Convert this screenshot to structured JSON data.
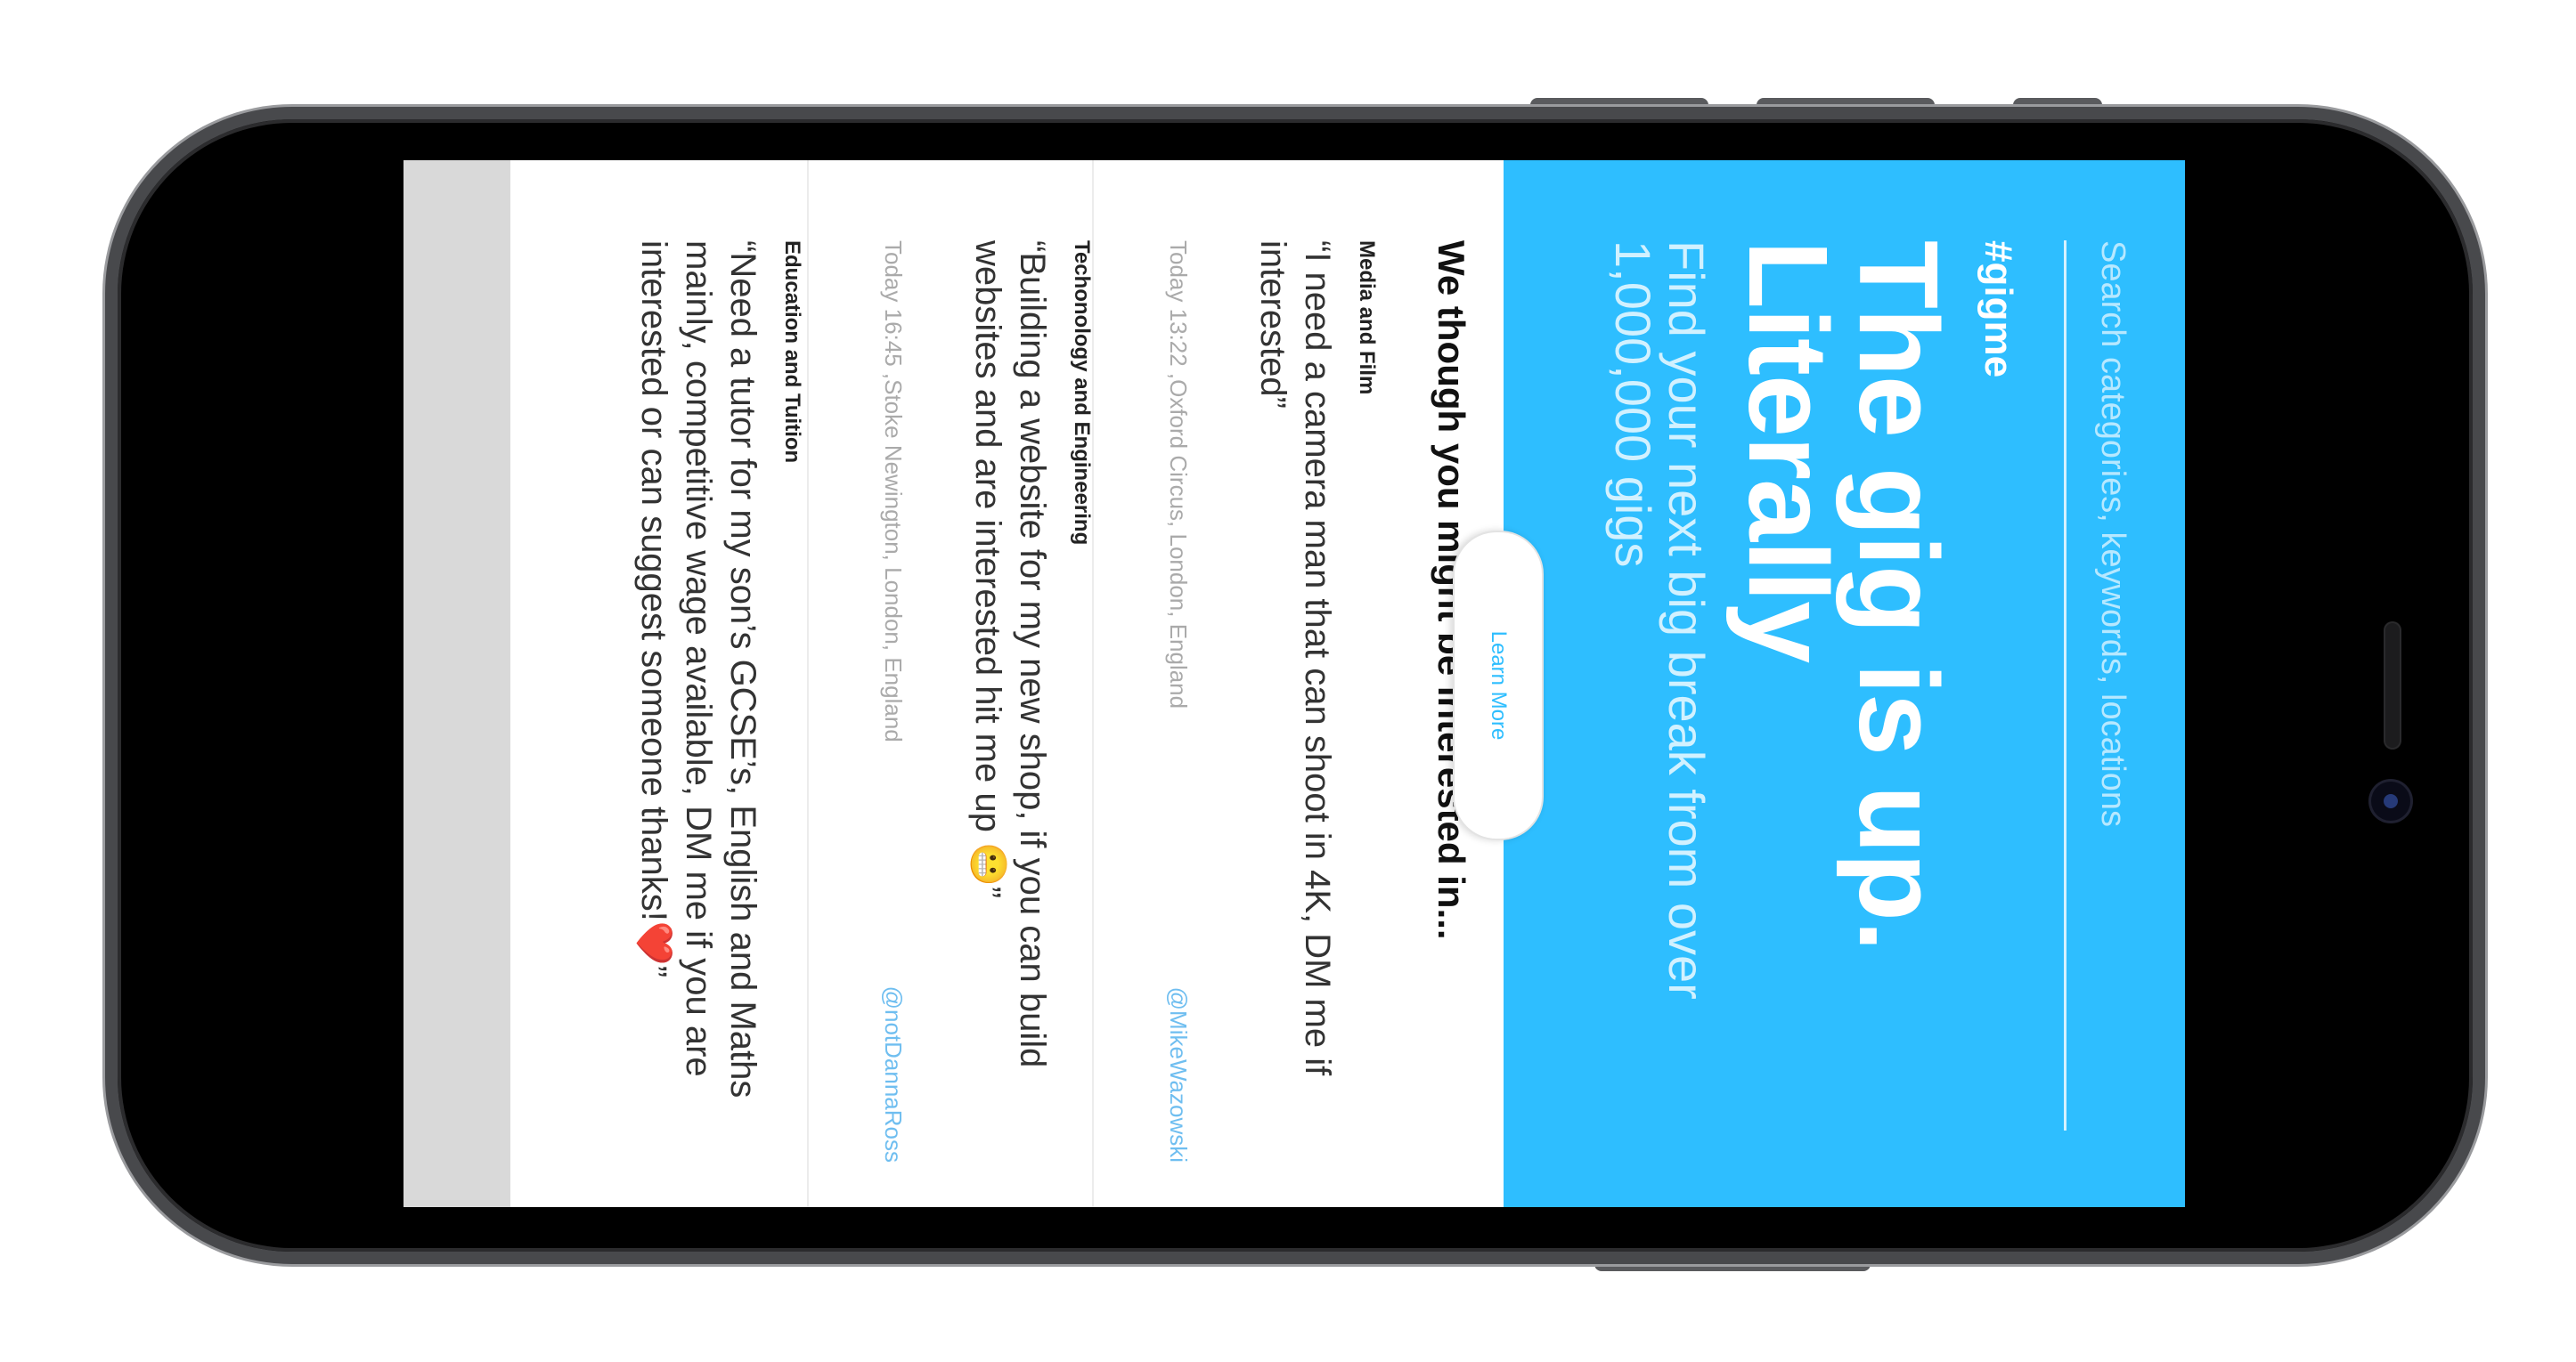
{
  "hero": {
    "search_placeholder": "Search categories, keywords, locations",
    "hashtag": "#gigme",
    "title": "The gig is up. Literally",
    "subtitle": "Find your next big break from over 1,000,000 gigs",
    "learn_more": "Learn More",
    "background_color": "#2ebeff"
  },
  "feed": {
    "heading": "We though you might be interested in...",
    "posts": [
      {
        "category": "Media and Film",
        "text": "“I need a camera man that can shoot in 4K, DM me if interested”",
        "meta": "Today 13:22 ,Oxford Circus, London, England",
        "handle": "@MikeWazowski"
      },
      {
        "category": "Techonology and Engineering",
        "text": "“Building a website for my new shop, if you can build websites and are interested hit me up 😬”",
        "meta": "Today 16:45 ,Stoke Newington, London, England",
        "handle": "@notDannaRoss"
      },
      {
        "category": "Education and Tuition",
        "text": "“Need a tutor for my son’s GCSE’s, English and Maths mainly, competitive wage available, DM me if you are interested or can suggest someone thanks!❤️”",
        "meta": "",
        "handle": ""
      }
    ]
  }
}
